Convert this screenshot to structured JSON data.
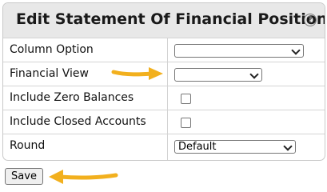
{
  "header": {
    "title": "Edit Statement Of Financial Position",
    "help_icon": "help-circle-icon",
    "help_glyph": "?"
  },
  "form": {
    "rows": [
      {
        "label": "Column Option",
        "control": "select",
        "value": ""
      },
      {
        "label": "Financial View",
        "control": "select",
        "value": ""
      },
      {
        "label": "Include Zero Balances",
        "control": "checkbox",
        "checked": false
      },
      {
        "label": "Include Closed Accounts",
        "control": "checkbox",
        "checked": false
      },
      {
        "label": "Round",
        "control": "select",
        "value": "Default"
      }
    ]
  },
  "actions": {
    "save_label": "Save"
  },
  "colors": {
    "arrow": "#f2b01e",
    "header_bg": "#e8e8e8"
  },
  "annotations": [
    {
      "name": "arrow-icon",
      "points_to": "Financial View select"
    },
    {
      "name": "arrow-icon",
      "points_to": "Save button"
    }
  ]
}
